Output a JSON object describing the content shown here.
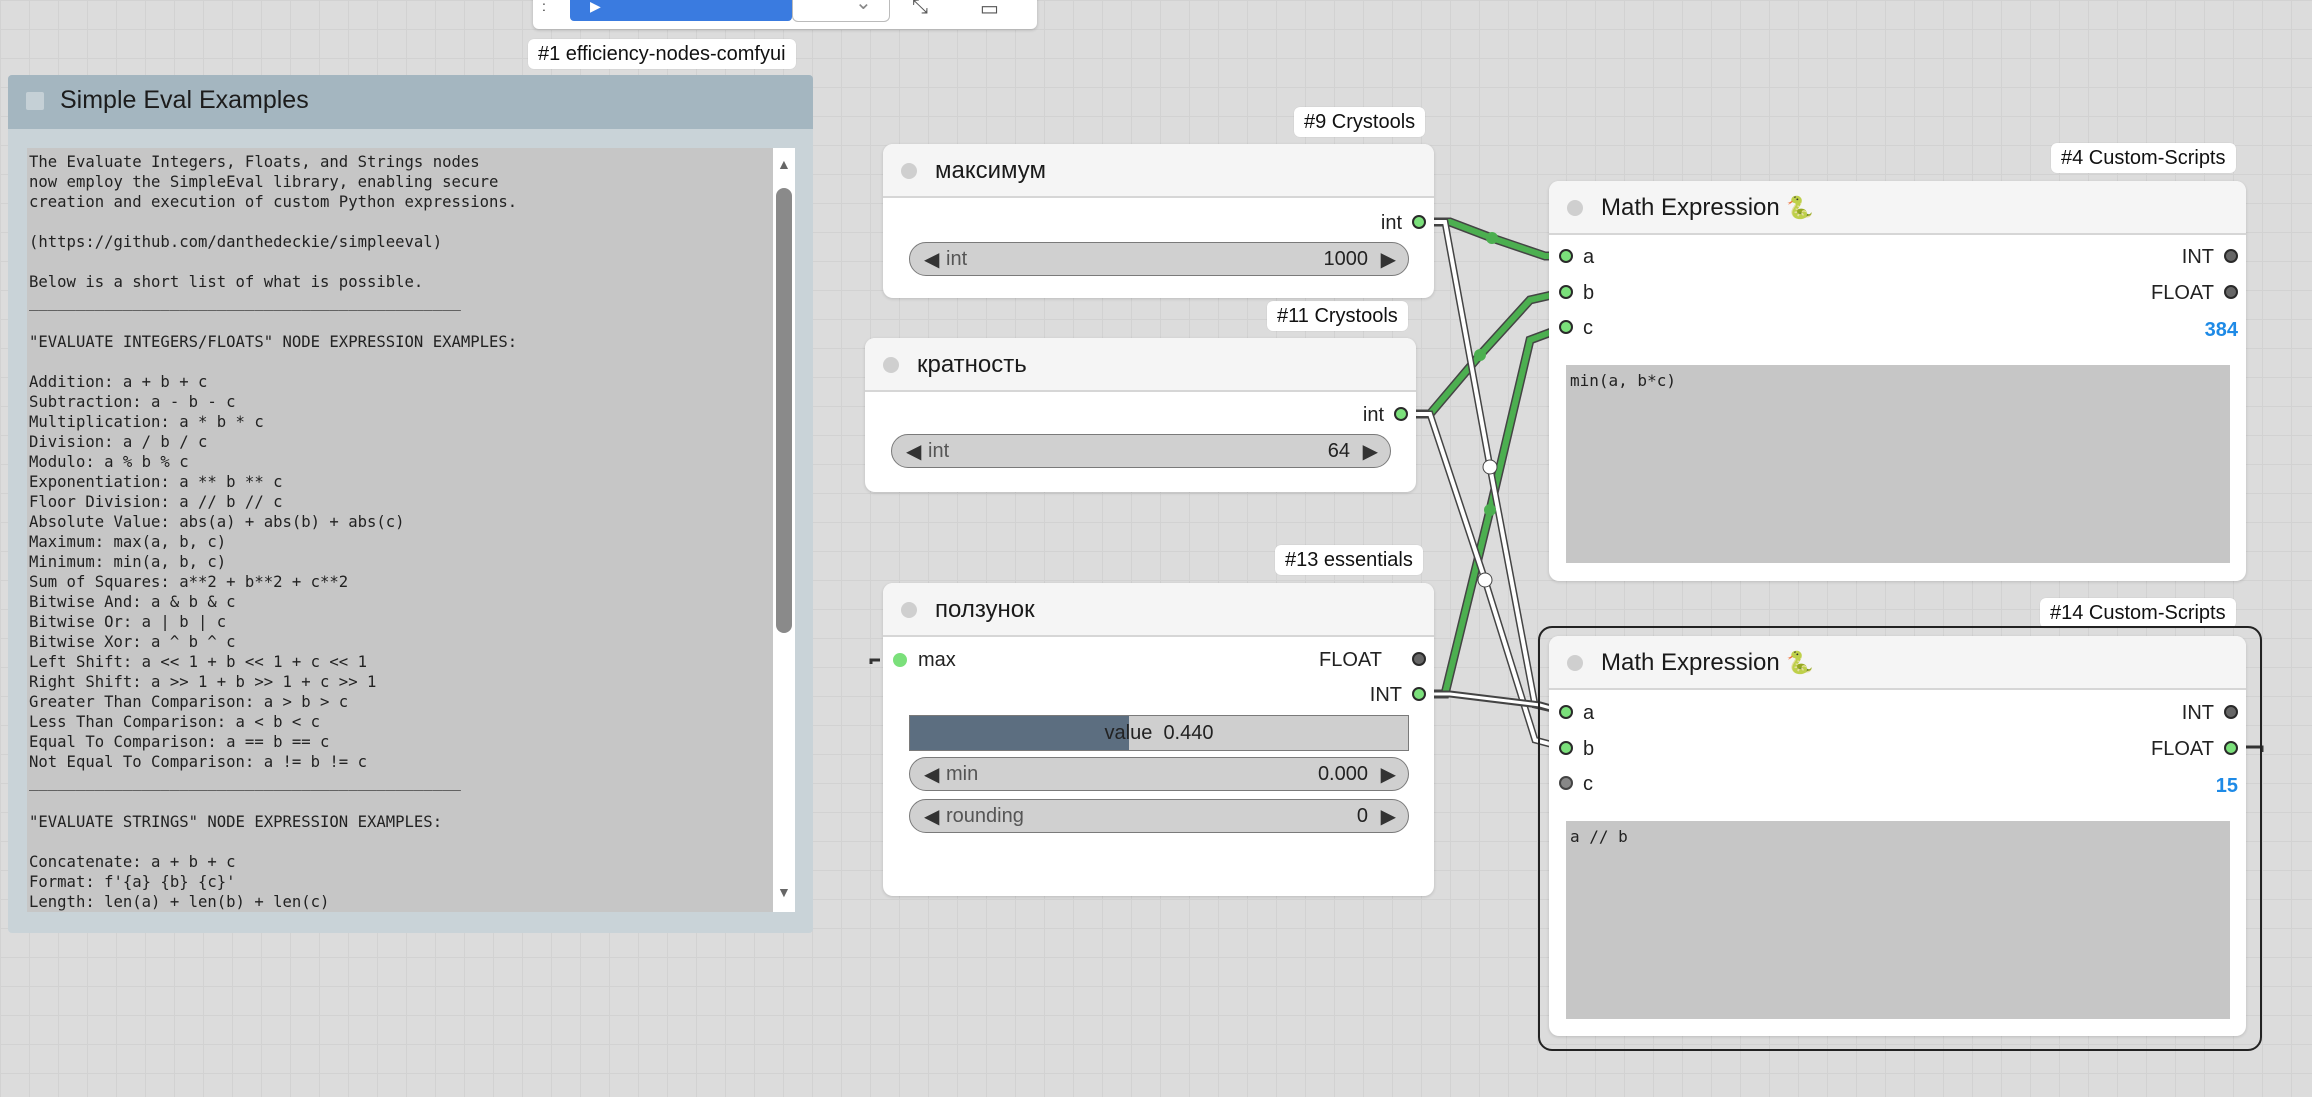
{
  "toolbar": {
    "run_label": "",
    "icons": [
      "run-icon",
      "dropdown-chevron-icon",
      "expand-icon",
      "panel-icon"
    ]
  },
  "badges": {
    "note": "#1 efficiency-nodes-comfyui",
    "max": "#9 Crystools",
    "mult": "#11 Crystools",
    "slider": "#13 essentials",
    "math1": "#4 Custom-Scripts",
    "math2": "#14 Custom-Scripts"
  },
  "note": {
    "title": "Simple Eval Examples",
    "text": "The Evaluate Integers, Floats, and Strings nodes\nnow employ the SimpleEval library, enabling secure\ncreation and execution of custom Python expressions.\n\n(https://github.com/danthedeckie/simpleeval)\n\nBelow is a short list of what is possible.\n______________________________________________\n\n\"EVALUATE INTEGERS/FLOATS\" NODE EXPRESSION EXAMPLES:\n\nAddition: a + b + c\nSubtraction: a - b - c\nMultiplication: a * b * c\nDivision: a / b / c\nModulo: a % b % c\nExponentiation: a ** b ** c\nFloor Division: a // b // c\nAbsolute Value: abs(a) + abs(b) + abs(c)\nMaximum: max(a, b, c)\nMinimum: min(a, b, c)\nSum of Squares: a**2 + b**2 + c**2\nBitwise And: a & b & c\nBitwise Or: a | b | c\nBitwise Xor: a ^ b ^ c\nLeft Shift: a << 1 + b << 1 + c << 1\nRight Shift: a >> 1 + b >> 1 + c >> 1\nGreater Than Comparison: a > b > c\nLess Than Comparison: a < b < c\nEqual To Comparison: a == b == c\nNot Equal To Comparison: a != b != c\n______________________________________________\n\n\"EVALUATE STRINGS\" NODE EXPRESSION EXAMPLES:\n\nConcatenate: a + b + c\nFormat: f'{a} {b} {c}'\nLength: len(a) + len(b) + len(c)"
  },
  "node_max": {
    "title": "максимум",
    "out_label": "int",
    "widget_name": "int",
    "widget_value": "1000"
  },
  "node_mult": {
    "title": "кратность",
    "out_label": "int",
    "widget_name": "int",
    "widget_value": "64"
  },
  "node_slider": {
    "title": "ползунок",
    "in_label": "max",
    "out_float": "FLOAT",
    "out_int": "INT",
    "value_label": "value",
    "value": "0.440",
    "value_fraction": 0.44,
    "min_label": "min",
    "min_value": "0.000",
    "rounding_label": "rounding",
    "rounding_value": "0"
  },
  "math1": {
    "title": "Math Expression",
    "emoji": "🐍",
    "inputs": [
      "a",
      "b",
      "c"
    ],
    "out_int": "INT",
    "out_float": "FLOAT",
    "result": "384",
    "expression": "min(a, b*c)"
  },
  "math2": {
    "title": "Math Expression",
    "emoji": "🐍",
    "inputs": [
      "a",
      "b",
      "c"
    ],
    "out_int": "INT",
    "out_float": "FLOAT",
    "result": "15",
    "expression": "a // b"
  },
  "colors": {
    "link_green": "#4caf50",
    "link_white": "#ffffff",
    "value_blue": "#1e8ae6",
    "slider_fill": "#5c6e80"
  }
}
